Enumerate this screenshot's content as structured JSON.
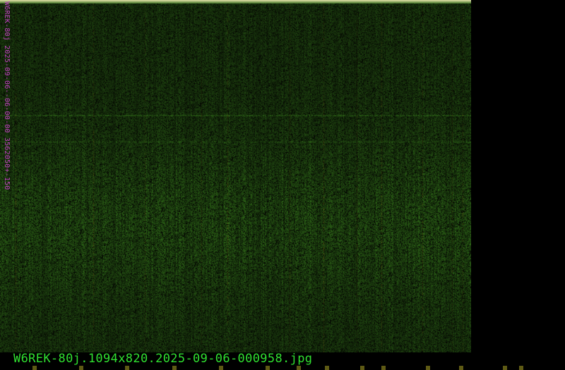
{
  "image": {
    "side_label": "W6REK-80j 2025-09-06--06-00-00 3562050+-150",
    "filename": "W6REK-80j.1094x820.2025-09-06-000958.jpg"
  },
  "colors": {
    "background": "#000000",
    "waterfall_dark": "#0b1606",
    "waterfall_green": "#2f6a18",
    "waterfall_olive": "#5a5a12",
    "top_band": "#d8d8a0",
    "label_magenta": "#c040c0",
    "filename_green": "#30e030",
    "tick_olive": "#5e5a14"
  }
}
